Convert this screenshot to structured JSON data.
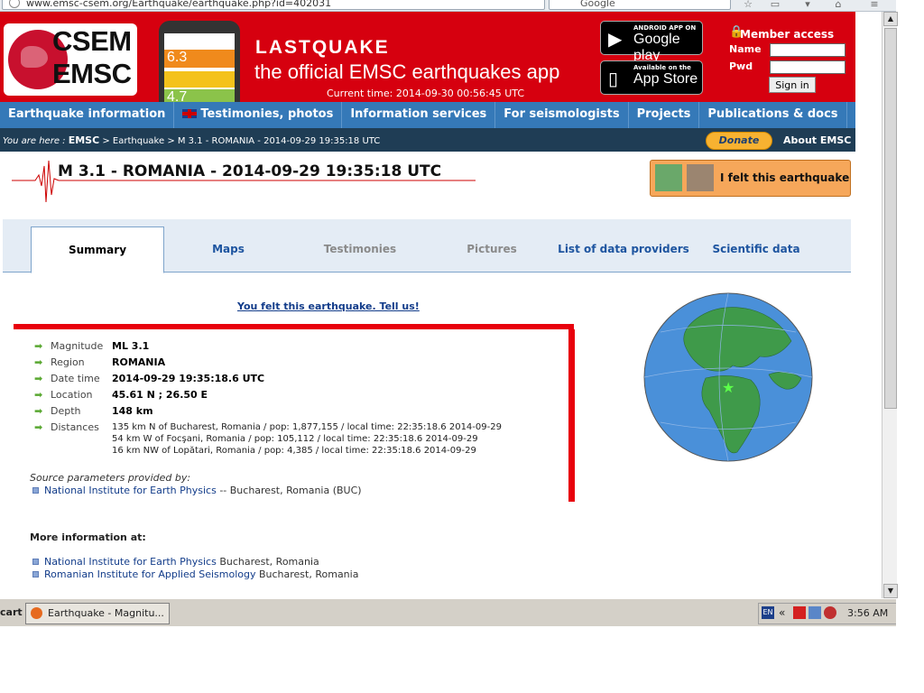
{
  "browser": {
    "url": "www.emsc-csem.org/Earthquake/earthquake.php?id=402031",
    "search_placeholder": "Google"
  },
  "header": {
    "logo_line1": "CSEM",
    "logo_line2": "EMSC",
    "app_title": "LASTQUAKE",
    "app_subtitle": "the official EMSC earthquakes app",
    "current_time": "Current time: 2014-09-30 00:56:45 UTC",
    "phone_mags": [
      "6.3",
      "4.7"
    ],
    "google_play_small": "ANDROID APP ON",
    "google_play_big": "Google play",
    "appstore_small": "Available on the",
    "appstore_big": "App Store",
    "member_title": "Member access",
    "name_label": "Name",
    "pwd_label": "Pwd",
    "signin_label": "Sign in"
  },
  "nav": {
    "items": [
      "Earthquake information",
      "Testimonies, photos",
      "Information services",
      "For seismologists",
      "Projects",
      "Publications & docs"
    ]
  },
  "breadcrumb": {
    "prefix": "You are here :",
    "root": "EMSC",
    "trail": " > Earthquake > M 3.1 - ROMANIA - 2014-09-29 19:35:18 UTC",
    "donate_label": "Donate",
    "about_label": "About EMSC"
  },
  "event": {
    "title": "M 3.1 - ROMANIA - 2014-09-29 19:35:18 UTC",
    "felt_button": "I felt this earthquake"
  },
  "tabs": [
    {
      "label": "Summary"
    },
    {
      "label": "Maps"
    },
    {
      "label": "Testimonies"
    },
    {
      "label": "Pictures"
    },
    {
      "label": "List of data providers"
    },
    {
      "label": "Scientific data"
    }
  ],
  "summary": {
    "tell_us": "You felt this earthquake. Tell us!",
    "params": [
      {
        "key": "Magnitude",
        "value": "ML 3.1"
      },
      {
        "key": "Region",
        "value": "ROMANIA"
      },
      {
        "key": "Date time",
        "value": "2014-09-29 19:35:18.6 UTC"
      },
      {
        "key": "Location",
        "value": "45.61 N ; 26.50 E"
      },
      {
        "key": "Depth",
        "value": "148 km"
      },
      {
        "key": "Distances",
        "value": ""
      }
    ],
    "distances": [
      "135 km N of Bucharest, Romania / pop: 1,877,155 / local time: 22:35:18.6 2014-09-29",
      "54 km W of Focşani, Romania / pop: 105,112 / local time: 22:35:18.6 2014-09-29",
      "16 km NW of Lopătari, Romania / pop: 4,385 / local time: 22:35:18.6 2014-09-29"
    ],
    "source_label": "Source parameters provided by:",
    "source_link": "National Institute for Earth Physics",
    "source_suffix": "-- Bucharest, Romania (BUC)",
    "more_info_label": "More information at:",
    "more_links": [
      {
        "name": "National Institute for Earth Physics",
        "place": "Bucharest, Romania"
      },
      {
        "name": "Romanian Institute for Applied Seismology",
        "place": "Bucharest, Romania"
      }
    ]
  },
  "taskbar": {
    "start_label": "cart",
    "window_label": "Earthquake - Magnitu...",
    "lang": "EN",
    "clock": "3:56 AM"
  },
  "colors": {
    "header_red": "#d6000f",
    "nav_blue": "#3579b8",
    "crumb_dark": "#1f3d55",
    "felt_orange": "#f6a75a",
    "marker_red": "#e8000c"
  }
}
